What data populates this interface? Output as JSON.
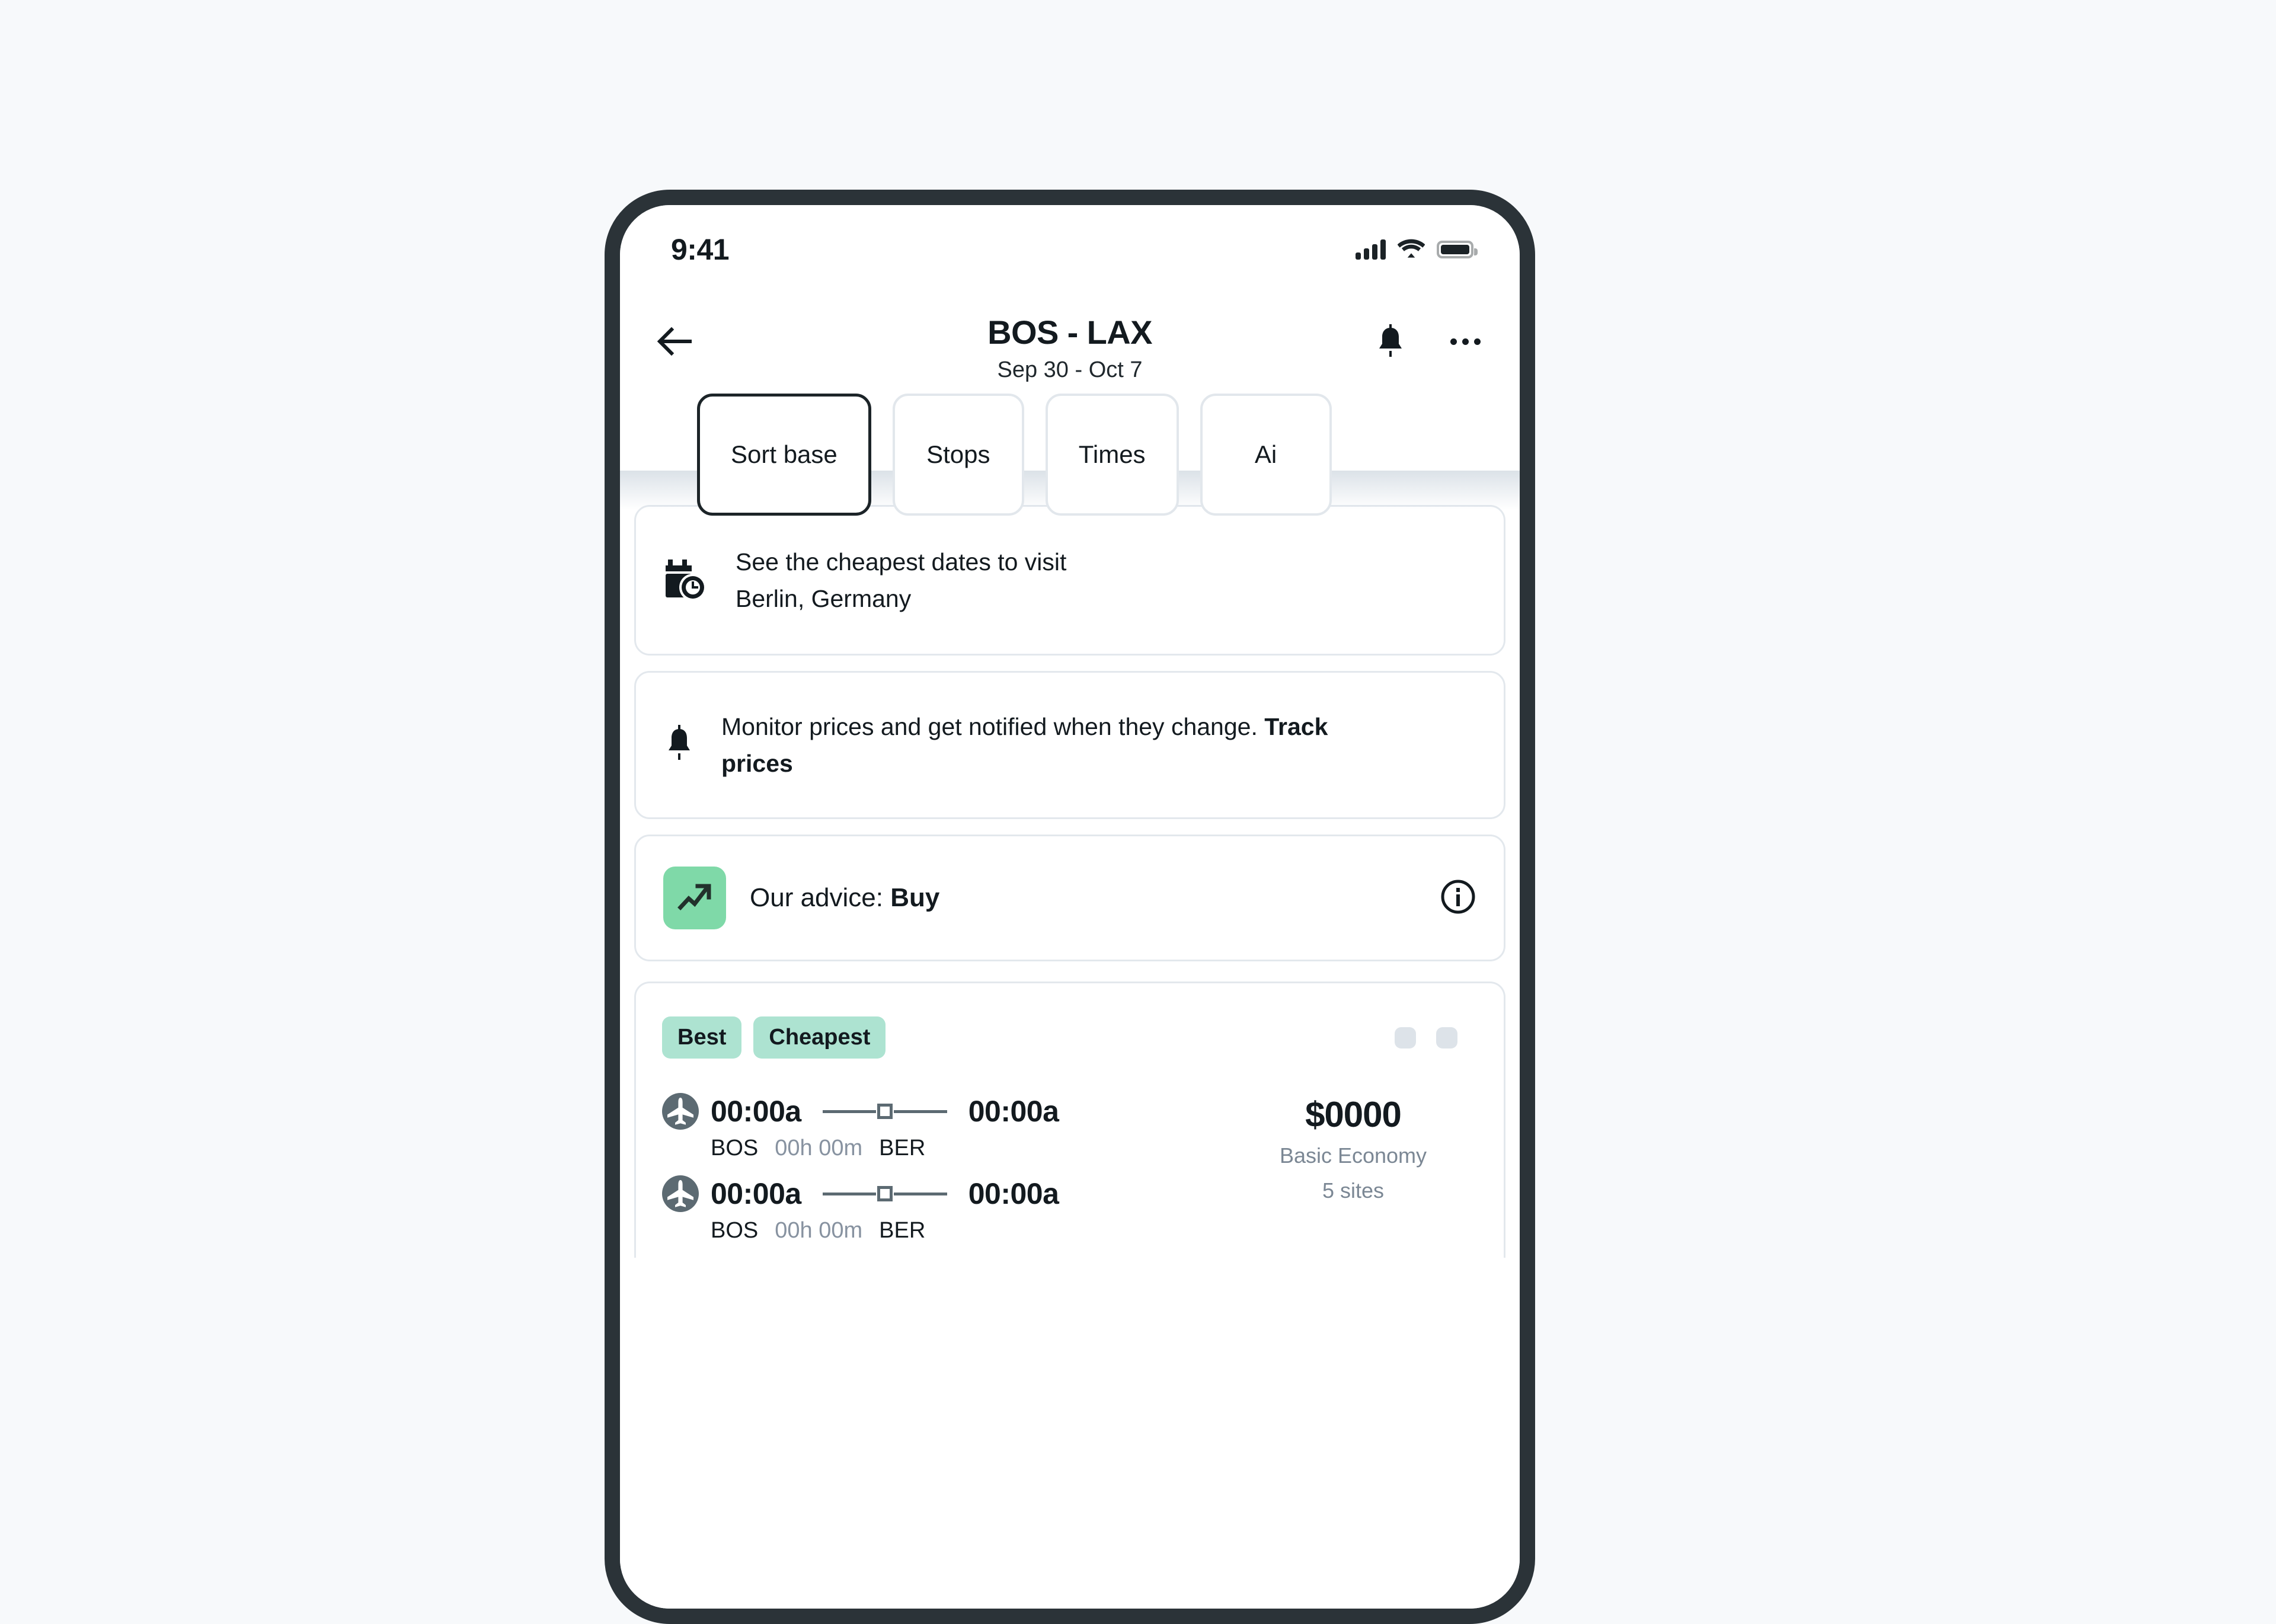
{
  "page": {
    "background_color": "#f7f9fb",
    "frame_color": "#2b3338"
  },
  "status_bar": {
    "time": "9:41",
    "cellular_icon": "signal-bars-icon",
    "wifi_icon": "wifi-icon",
    "battery_icon": "battery-icon"
  },
  "header": {
    "back_icon": "arrow-left-icon",
    "title": "BOS - LAX",
    "subtitle": "Sep 30 - Oct 7",
    "bell_icon": "bell-icon",
    "more_icon": "more-horizontal-icon"
  },
  "filters": {
    "chips": [
      {
        "label": "Sort base",
        "active": true
      },
      {
        "label": "Stops",
        "active": false
      },
      {
        "label": "Times",
        "active": false
      },
      {
        "label": "Ai",
        "active": false
      }
    ]
  },
  "cards": {
    "cheapest_dates": {
      "icon": "calendar-clock-icon",
      "line1": "See the cheapest dates to visit",
      "line2": "Berlin, Germany"
    },
    "track_prices": {
      "icon": "bell-icon",
      "text": "Monitor prices and get notified when they change. ",
      "link_label": "Track prices"
    },
    "advice": {
      "icon": "trending-up-icon",
      "icon_bg": "#7fd9a8",
      "label": "Our advice: ",
      "value": "Buy",
      "info_icon": "info-circle-icon"
    }
  },
  "results": {
    "badges": [
      {
        "label": "Best",
        "color": "#ade3d1"
      },
      {
        "label": "Cheapest",
        "color": "#ade3d1"
      }
    ],
    "pager_dots": 2,
    "legs": [
      {
        "airline_icon": "airplane-avatar-icon",
        "depart_time": "00:00a",
        "arrive_time": "00:00a",
        "origin": "BOS",
        "duration": "00h 00m",
        "destination": "BER"
      },
      {
        "airline_icon": "airplane-avatar-icon",
        "depart_time": "00:00a",
        "arrive_time": "00:00a",
        "origin": "BOS",
        "duration": "00h 00m",
        "destination": "BER"
      }
    ],
    "price": {
      "amount": "$0000",
      "fare_class": "Basic Economy",
      "sites": "5 sites"
    }
  }
}
